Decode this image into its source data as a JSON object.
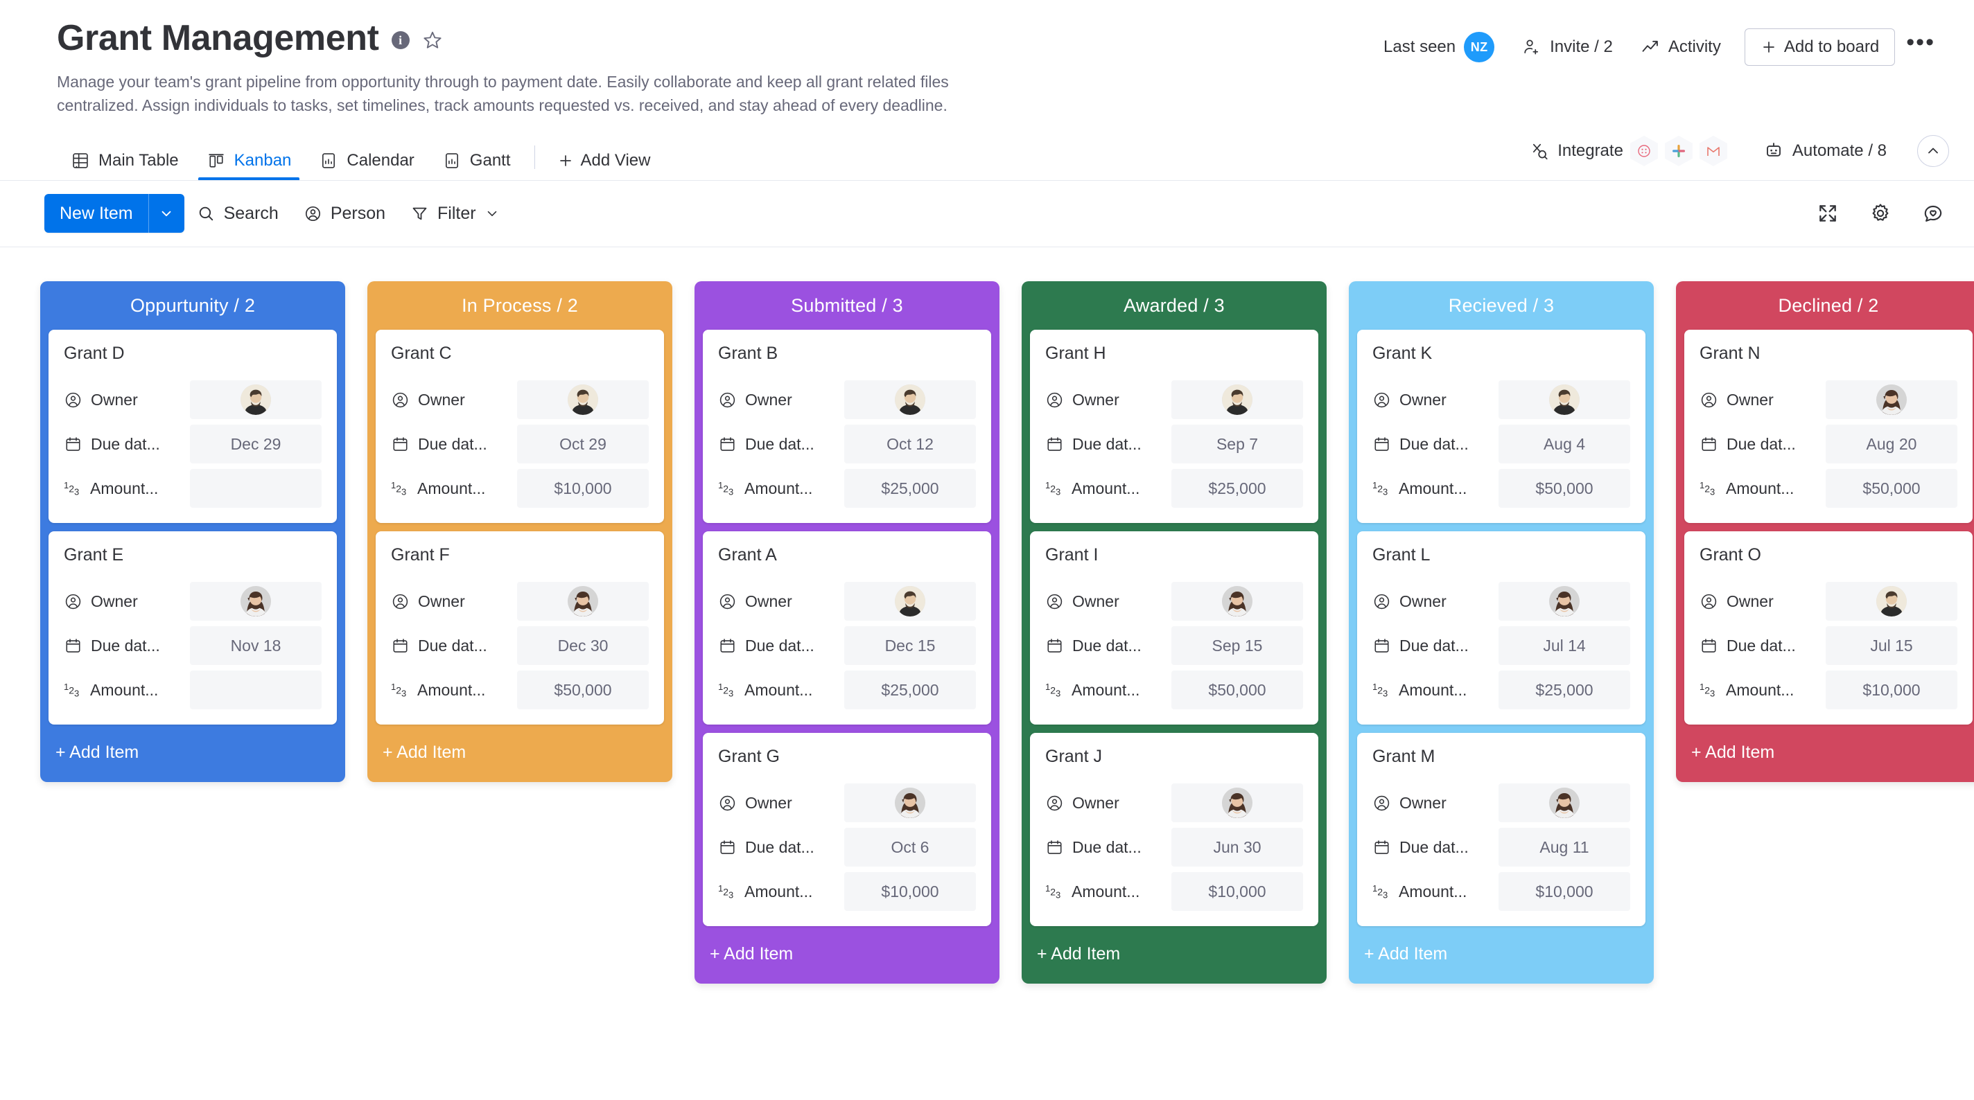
{
  "header": {
    "title": "Grant Management",
    "info_icon": "info-icon",
    "star_icon": "star-outline-icon",
    "description": "Manage your team's grant pipeline from opportunity through to payment date. Easily collaborate and keep all grant related files centralized. Assign individuals to tasks, set timelines, track amounts requested vs. received, and stay ahead of every deadline.",
    "last_seen_label": "Last seen",
    "last_seen_initials": "NZ",
    "invite_label": "Invite / 2",
    "activity_label": "Activity",
    "add_to_board_label": "Add to board",
    "more_label": "•••"
  },
  "tabs": [
    {
      "label": "Main Table",
      "icon": "main-table-icon",
      "active": false
    },
    {
      "label": "Kanban",
      "icon": "kanban-icon",
      "active": true
    },
    {
      "label": "Calendar",
      "icon": "calendar-view-icon",
      "active": false
    },
    {
      "label": "Gantt",
      "icon": "gantt-icon",
      "active": false
    }
  ],
  "add_view_label": "Add View",
  "tabbar_right": {
    "integrate_label": "Integrate",
    "integration_icons": [
      "monday-dots-icon",
      "slack-icon",
      "gmail-icon"
    ],
    "automate_label": "Automate / 8",
    "collapse_icon": "chevron-up-icon"
  },
  "toolbar": {
    "new_item_label": "New Item",
    "new_item_caret": "chevron-down-icon",
    "search_label": "Search",
    "person_label": "Person",
    "filter_label": "Filter",
    "filter_caret": "chevron-down-icon",
    "right_icons": [
      "expand-icon",
      "gear-icon",
      "chat-heart-icon"
    ]
  },
  "board": {
    "add_item_label": "+ Add Item",
    "field_labels": {
      "owner": "Owner",
      "due_date": "Due dat...",
      "amount": "Amount..."
    },
    "columns": [
      {
        "title": "Oppurtunity / 2",
        "color": "#3d7be0",
        "cards": [
          {
            "title": "Grant D",
            "owner": "man-avatar",
            "due": "Dec 29",
            "amount": ""
          },
          {
            "title": "Grant E",
            "owner": "woman-avatar",
            "due": "Nov 18",
            "amount": ""
          }
        ]
      },
      {
        "title": "In Process / 2",
        "color": "#edaa4e",
        "cards": [
          {
            "title": "Grant C",
            "owner": "man-avatar",
            "due": "Oct 29",
            "amount": "$10,000"
          },
          {
            "title": "Grant F",
            "owner": "woman-avatar",
            "due": "Dec 30",
            "amount": "$50,000"
          }
        ]
      },
      {
        "title": "Submitted / 3",
        "color": "#9b51e0",
        "cards": [
          {
            "title": "Grant B",
            "owner": "man-avatar",
            "due": "Oct 12",
            "amount": "$25,000"
          },
          {
            "title": "Grant A",
            "owner": "man-avatar",
            "due": "Dec 15",
            "amount": "$25,000"
          },
          {
            "title": "Grant G",
            "owner": "woman-avatar",
            "due": "Oct 6",
            "amount": "$10,000"
          }
        ]
      },
      {
        "title": "Awarded / 3",
        "color": "#2d7a4f",
        "cards": [
          {
            "title": "Grant H",
            "owner": "man-avatar",
            "due": "Sep 7",
            "amount": "$25,000"
          },
          {
            "title": "Grant I",
            "owner": "woman-avatar",
            "due": "Sep 15",
            "amount": "$50,000"
          },
          {
            "title": "Grant J",
            "owner": "woman-avatar",
            "due": "Jun 30",
            "amount": "$10,000"
          }
        ]
      },
      {
        "title": "Recieved / 3",
        "color": "#7dcdf7",
        "cards": [
          {
            "title": "Grant K",
            "owner": "man-avatar",
            "due": "Aug 4",
            "amount": "$50,000"
          },
          {
            "title": "Grant L",
            "owner": "woman-avatar",
            "due": "Jul 14",
            "amount": "$25,000"
          },
          {
            "title": "Grant M",
            "owner": "woman-avatar",
            "due": "Aug 11",
            "amount": "$10,000"
          }
        ]
      },
      {
        "title": "Declined / 2",
        "color": "#d1475f",
        "cards": [
          {
            "title": "Grant N",
            "owner": "woman-avatar",
            "due": "Aug 20",
            "amount": "$50,000"
          },
          {
            "title": "Grant O",
            "owner": "man-avatar",
            "due": "Jul 15",
            "amount": "$10,000"
          }
        ]
      }
    ]
  }
}
